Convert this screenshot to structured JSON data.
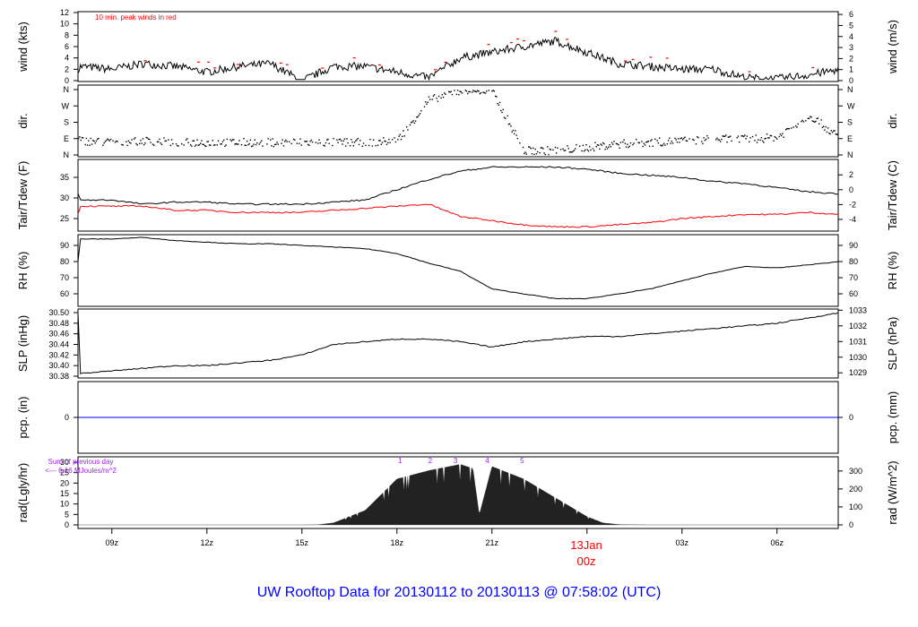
{
  "title": "UW Rooftop Data for 20130112  to  20130113 @ 07:58:02  (UTC)",
  "chart_data": [
    {
      "type": "line",
      "panel": "wind",
      "ylabel_left": "wind (kts)",
      "ylabel_right": "wind (m/s)",
      "annotation": "10 min. peak winds in red",
      "ylim": [
        0,
        12
      ],
      "left_ticks": [
        0,
        2,
        4,
        6,
        8,
        10,
        12
      ],
      "right_ticks": [
        0,
        1,
        2,
        3,
        4,
        5,
        6
      ],
      "hours": [
        8,
        9,
        10,
        11,
        12,
        13,
        14,
        15,
        16,
        17,
        18,
        19,
        20,
        21,
        22,
        23,
        24,
        25,
        26,
        27,
        28,
        29,
        30,
        31,
        32
      ],
      "series": [
        {
          "name": "wind speed",
          "color": "#000000",
          "values": [
            2.5,
            2,
            3,
            2.5,
            1.5,
            2.5,
            3,
            0,
            2.5,
            2.5,
            1.5,
            0.5,
            4,
            5,
            6,
            7,
            5,
            3,
            2.5,
            2,
            2,
            0.5,
            0.3,
            1,
            2
          ]
        }
      ],
      "peak_color": "#ff0000"
    },
    {
      "type": "scatter",
      "panel": "dir",
      "ylabel_left": "dir.",
      "ylabel_right": "dir.",
      "categories": [
        "N",
        "E",
        "S",
        "W",
        "N"
      ],
      "hours": [
        8,
        9,
        10,
        11,
        12,
        13,
        14,
        15,
        16,
        17,
        18,
        19,
        20,
        21,
        22,
        23,
        24,
        25,
        26,
        27,
        28,
        29,
        30,
        31,
        32
      ],
      "values": [
        0.9,
        0.8,
        0.9,
        0.8,
        0.8,
        0.8,
        0.8,
        0.8,
        0.8,
        0.8,
        0.9,
        3.4,
        4,
        3.9,
        0.3,
        0.3,
        0.5,
        0.7,
        0.8,
        0.9,
        1,
        1,
        1.1,
        2.5,
        1
      ]
    },
    {
      "type": "line",
      "panel": "temp",
      "ylabel_left": "Tair/Tdew (F)",
      "ylabel_right": "Tair/Tdew (C)",
      "left_ticks": [
        25,
        30,
        35
      ],
      "right_ticks": [
        -4,
        -2,
        0,
        2
      ],
      "hours": [
        8,
        9,
        10,
        11,
        12,
        13,
        14,
        15,
        16,
        17,
        18,
        19,
        20,
        21,
        22,
        23,
        24,
        25,
        26,
        27,
        28,
        29,
        30,
        31,
        32
      ],
      "series": [
        {
          "name": "Tair",
          "color": "#000000",
          "values": [
            29.5,
            29.5,
            28.5,
            29,
            29,
            28.5,
            28.5,
            28.5,
            29,
            29.5,
            32,
            34.5,
            36.5,
            37.5,
            37.5,
            37.5,
            37,
            36,
            35.5,
            35,
            34,
            33.5,
            32.5,
            31.5,
            31
          ]
        },
        {
          "name": "Tdew",
          "color": "#ff0000",
          "values": [
            28,
            28,
            28,
            27,
            27,
            26.5,
            26.5,
            26.5,
            27,
            27.5,
            28,
            28.5,
            25.5,
            24.5,
            23.5,
            23,
            23,
            23.5,
            24,
            25,
            25.5,
            26,
            26,
            26.5,
            26
          ]
        }
      ]
    },
    {
      "type": "line",
      "panel": "rh",
      "ylabel_left": "RH (%)",
      "ylabel_right": "RH (%)",
      "left_ticks": [
        60,
        70,
        80,
        90
      ],
      "right_ticks": [
        60,
        70,
        80,
        90
      ],
      "hours": [
        8,
        9,
        10,
        11,
        12,
        13,
        14,
        15,
        16,
        17,
        18,
        19,
        20,
        21,
        22,
        23,
        24,
        25,
        26,
        27,
        28,
        29,
        30,
        31,
        32
      ],
      "series": [
        {
          "name": "RH",
          "color": "#000000",
          "values": [
            94,
            94,
            95,
            93,
            92,
            91,
            91,
            90,
            89,
            88,
            85,
            79,
            74,
            63,
            60,
            57,
            57,
            60,
            63,
            68,
            73,
            77,
            76,
            78,
            80
          ]
        }
      ]
    },
    {
      "type": "line",
      "panel": "slp",
      "ylabel_left": "SLP (inHg)",
      "ylabel_right": "SLP (hPa)",
      "left_ticks": [
        "30.38",
        "30.40",
        "30.42",
        "30.44",
        "30.46",
        "30.48",
        "30.50"
      ],
      "right_ticks": [
        1029,
        1030,
        1031,
        1032,
        1033
      ],
      "hours": [
        8,
        9,
        10,
        11,
        12,
        13,
        14,
        15,
        16,
        17,
        18,
        19,
        20,
        21,
        22,
        23,
        24,
        25,
        26,
        27,
        28,
        29,
        30,
        31,
        32
      ],
      "series": [
        {
          "name": "SLP",
          "color": "#000000",
          "values": [
            30.385,
            30.39,
            30.395,
            30.4,
            30.4,
            30.405,
            30.41,
            30.42,
            30.44,
            30.445,
            30.45,
            30.45,
            30.445,
            30.435,
            30.445,
            30.45,
            30.455,
            30.455,
            30.46,
            30.465,
            30.47,
            30.475,
            30.48,
            30.49,
            30.5
          ]
        }
      ]
    },
    {
      "type": "line",
      "panel": "pcp",
      "ylabel_left": "pcp. (in)",
      "ylabel_right": "pcp. (mm)",
      "left_ticks": [
        0
      ],
      "right_ticks": [
        0
      ],
      "hours": [
        8,
        32
      ],
      "series": [
        {
          "name": "precip",
          "color": "#0000ff",
          "values": [
            0,
            0
          ]
        }
      ]
    },
    {
      "type": "area",
      "panel": "rad",
      "ylabel_left": "rad(Lgly/hr)",
      "ylabel_right": "rad (W/m^2)",
      "left_ticks": [
        0,
        5,
        10,
        15,
        20,
        25,
        30
      ],
      "right_ticks": [
        0,
        100,
        200,
        300
      ],
      "sum_label": "Sum of previous day",
      "sum_value": "<--- 6.16 MJoules/m^2",
      "hour_markers": [
        "1",
        "2",
        "3",
        "4",
        "5"
      ],
      "hour_marker_hours": [
        18.1,
        19.05,
        19.85,
        20.85,
        21.95
      ],
      "annot_color": "#a020f0",
      "hours": [
        8,
        9,
        10,
        11,
        12,
        13,
        14,
        15,
        15.5,
        16,
        17,
        18,
        19,
        20,
        20.4,
        20.6,
        21,
        22,
        23,
        24,
        24.5,
        25,
        26,
        32
      ],
      "series": [
        {
          "name": "solar radiation",
          "color": "#222222",
          "values": [
            0,
            0,
            0,
            0,
            0,
            0,
            0,
            0,
            0.1,
            1,
            7,
            22,
            26,
            29,
            27,
            5,
            28,
            22,
            13,
            4,
            1,
            0.2,
            0,
            0
          ]
        }
      ]
    }
  ],
  "x_axis": {
    "ticks": [
      "09z",
      "12z",
      "15z",
      "18z",
      "21z",
      "00z",
      "03z",
      "06z"
    ],
    "tick_hours": [
      9,
      12,
      15,
      18,
      21,
      24,
      27,
      30
    ],
    "date_label": "13Jan",
    "date_tick": "00z",
    "date_color": "#ff0000"
  }
}
